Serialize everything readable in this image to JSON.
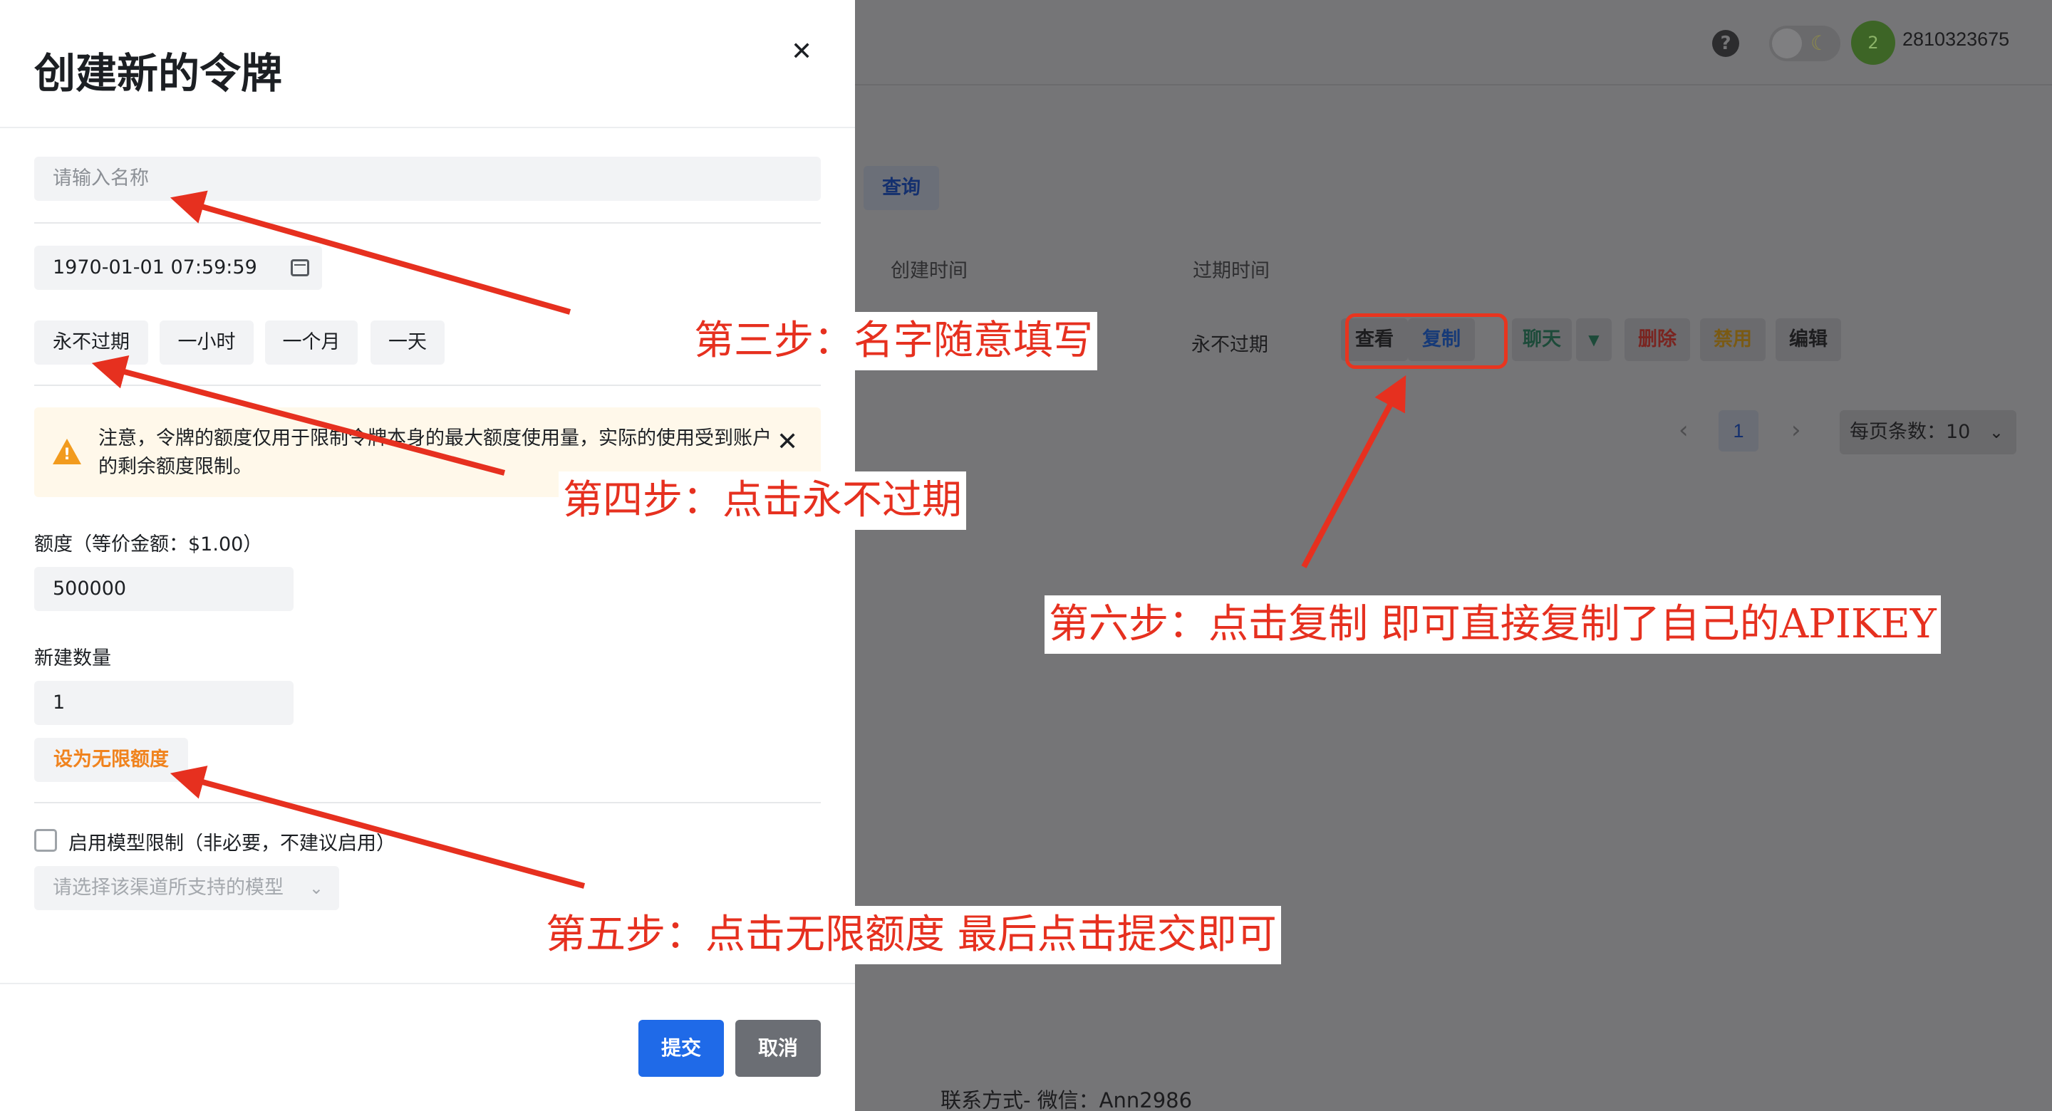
{
  "modal": {
    "title": "创建新的令牌",
    "name_placeholder": "请输入名称",
    "expire_date": "1970-01-01 07:59:59",
    "quick_options": [
      "永不过期",
      "一小时",
      "一个月",
      "一天"
    ],
    "notice": "注意，令牌的额度仅用于限制令牌本身的最大额度使用量，实际的使用受到账户的剩余额度限制。",
    "quota_label": "额度（等价金额：$1.00）",
    "quota_value": "500000",
    "count_label": "新建数量",
    "count_value": "1",
    "unlimited_label": "设为无限额度",
    "model_limit_label": "启用模型限制（非必要，不建议启用）",
    "model_select_placeholder": "请选择该渠道所支持的模型",
    "submit_label": "提交",
    "cancel_label": "取消"
  },
  "header": {
    "help": "?",
    "avatar_letter": "2",
    "username": "2810323675"
  },
  "table": {
    "query_label": "查询",
    "columns": [
      "创建时间",
      "过期时间"
    ],
    "row": {
      "expire": "永不过期",
      "actions": {
        "view": "查看",
        "copy": "复制",
        "chat": "聊天",
        "delete": "删除",
        "disable": "禁用",
        "edit": "编辑"
      }
    }
  },
  "pagination": {
    "current_page": "1",
    "page_size_label": "每页条数：10"
  },
  "footer": {
    "contact": "联系方式- 微信：Ann2986"
  },
  "annotations": {
    "step3": "第三步：名字随意填写",
    "step4": "第四步：点击永不过期",
    "step5": "第五步：点击无限额度  最后点击提交即可",
    "step6": "第六步：点击复制 即可直接复制了自己的APIKEY"
  },
  "colors": {
    "primary": "#1f6ae8",
    "annotation_red": "#e6301f",
    "warning": "#f29b1e",
    "unlimited_orange": "#f0831e"
  }
}
